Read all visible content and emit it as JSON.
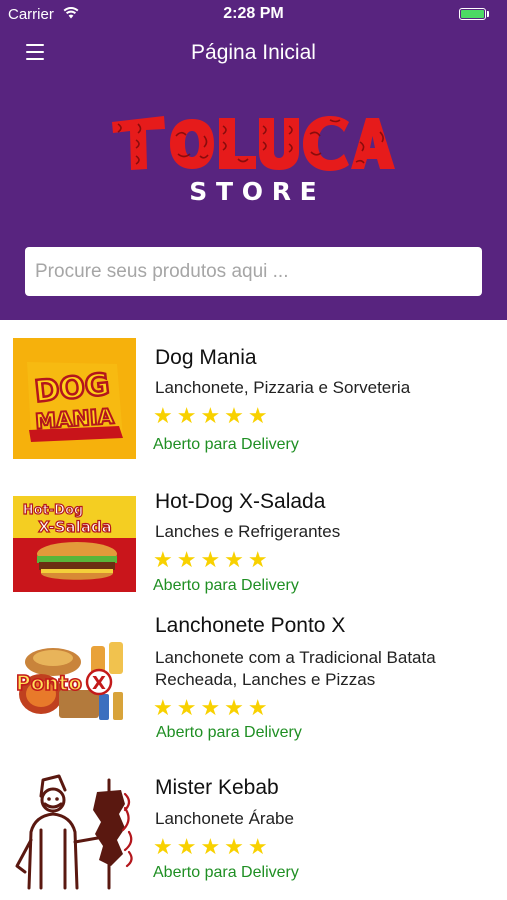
{
  "status_bar": {
    "carrier": "Carrier",
    "time": "2:28 PM",
    "battery_level": 1.0
  },
  "nav": {
    "title": "Página Inicial",
    "menu_icon": "hamburger-menu-icon"
  },
  "brand": {
    "name": "TOLUCA",
    "tagline": "S T O R E"
  },
  "search": {
    "placeholder": "Procure seus produtos aqui ...",
    "value": ""
  },
  "colors": {
    "header": "#58247f",
    "stars": "#f8d100",
    "delivery_status": "#1f8f23",
    "logo_red": "#e61b1b"
  },
  "stores": [
    {
      "name": "Dog Mania",
      "description": "Lanchonete, Pizzaria e Sorveteria",
      "rating": 5,
      "stars": "★★★★★",
      "status": "Aberto para Delivery",
      "logo_text": [
        "DOG",
        "MANIA"
      ]
    },
    {
      "name": "Hot-Dog X-Salada",
      "description": "Lanches e Refrigerantes",
      "rating": 5,
      "stars": "★★★★★",
      "status": "Aberto para Delivery",
      "logo_text": [
        "Hot-Dog",
        "X-Salada"
      ]
    },
    {
      "name": "Lanchonete Ponto X",
      "description": "Lanchonete com a Tradicional Batata Recheada, Lanches e Pizzas",
      "rating": 5,
      "stars": "★★★★★",
      "status": "Aberto para Delivery",
      "logo_text": [
        "Ponto",
        "X"
      ]
    },
    {
      "name": "Mister Kebab",
      "description": "Lanchonete Árabe",
      "rating": 5,
      "stars": "★★★★★",
      "status": "Aberto para Delivery",
      "logo_text": []
    }
  ]
}
